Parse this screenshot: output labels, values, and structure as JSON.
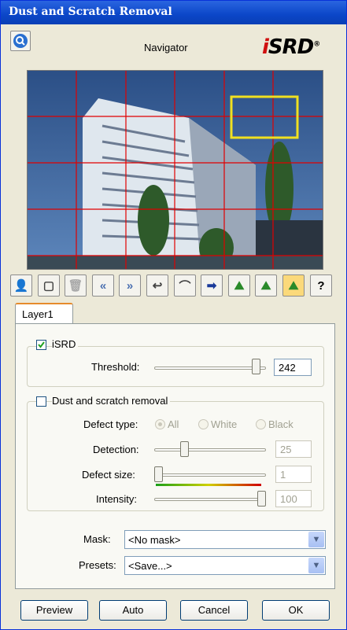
{
  "window": {
    "title": "Dust and Scratch Removal"
  },
  "navigator": {
    "label": "Navigator",
    "logo": "iSRD",
    "logo_mark": "®"
  },
  "toolbar": {
    "icons": [
      "scanner-person-icon",
      "new-page-icon",
      "delete-icon",
      "rewind-icon",
      "forward-icon",
      "rotate-icon",
      "lasso-icon",
      "arrow-right-icon",
      "mountain-check-icon",
      "mountain-icon",
      "mountain-checked-active-icon",
      "help-icon"
    ],
    "glyphs": [
      "👤",
      "▢",
      "🗑",
      "«",
      "»",
      "↩",
      "⌒",
      "➡",
      "⛰",
      "⛰",
      "⛰",
      "?"
    ],
    "colors": [
      "#7a4a2a",
      "#444",
      "#aaa",
      "#4a6fb0",
      "#4a6fb0",
      "#444",
      "#444",
      "#1a3a9a",
      "#2a8a2a",
      "#2a8a2a",
      "#2a8a2a",
      "#000"
    ]
  },
  "tabs": [
    {
      "label": "Layer1"
    }
  ],
  "isrd": {
    "checked": true,
    "label": "iSRD",
    "threshold_label": "Threshold:",
    "threshold_value": "242",
    "threshold_fraction": 0.95
  },
  "dust": {
    "checked": false,
    "label": "Dust and scratch removal",
    "defect_type_label": "Defect type:",
    "options": [
      "All",
      "White",
      "Black"
    ],
    "selected": "All",
    "detection_label": "Detection:",
    "detection_value": "25",
    "detection_fraction": 0.25,
    "defect_size_label": "Defect size:",
    "defect_size_value": "1",
    "defect_size_fraction": 0.0,
    "intensity_label": "Intensity:",
    "intensity_value": "100",
    "intensity_fraction": 1.0
  },
  "mask": {
    "label": "Mask:",
    "value": "<No mask>"
  },
  "presets": {
    "label": "Presets:",
    "value": "<Save...>"
  },
  "buttons": {
    "preview": "Preview",
    "auto": "Auto",
    "cancel": "Cancel",
    "ok": "OK"
  },
  "colors": {
    "title_bar": "#0b46c8",
    "grid_line": "#e00000",
    "selection": "#f0e020",
    "accent_tab": "#e68b2c"
  }
}
